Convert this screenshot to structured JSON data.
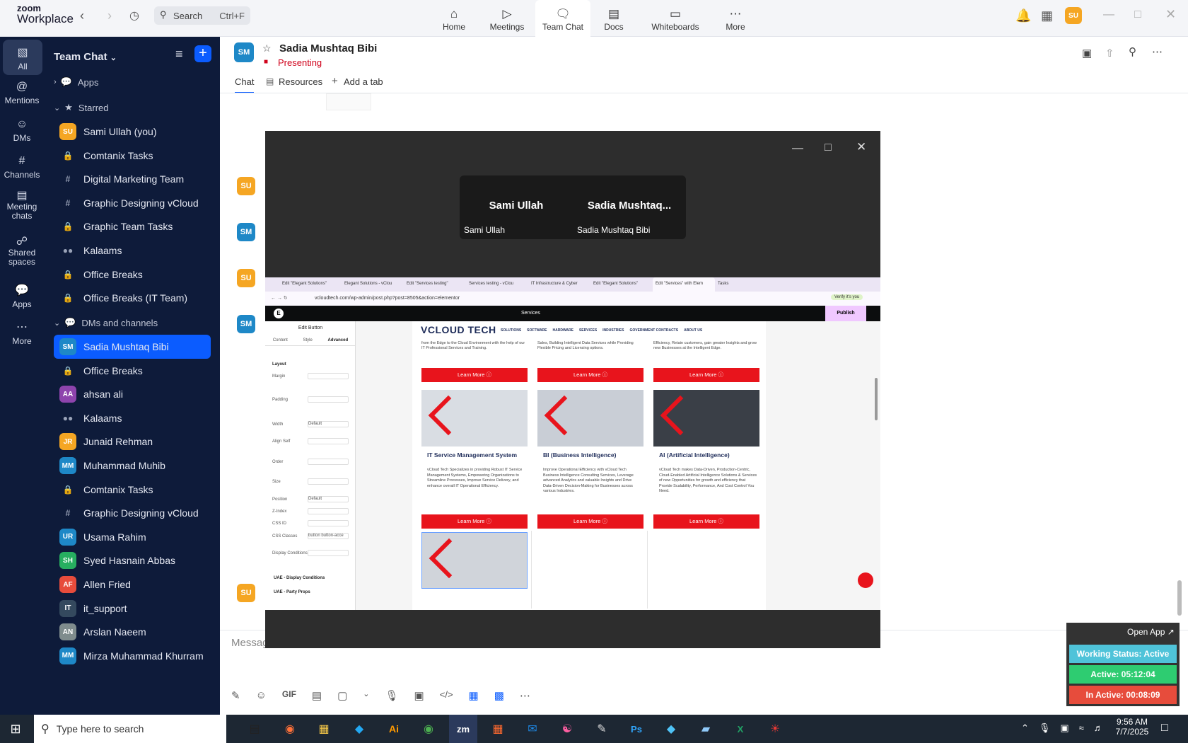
{
  "app": {
    "brand_top": "zoom",
    "brand_bottom": "Workplace"
  },
  "topbar": {
    "search_placeholder": "Search",
    "search_shortcut": "Ctrl+F",
    "nav": [
      {
        "label": "Home",
        "icon": "home-icon"
      },
      {
        "label": "Meetings",
        "icon": "video-icon"
      },
      {
        "label": "Team Chat",
        "icon": "chat-icon"
      },
      {
        "label": "Docs",
        "icon": "doc-icon"
      },
      {
        "label": "Whiteboards",
        "icon": "whiteboard-icon"
      },
      {
        "label": "More",
        "icon": "more-icon"
      }
    ],
    "avatar": "SU"
  },
  "rail": [
    {
      "label": "All",
      "icon": "chat-icon"
    },
    {
      "label": "Mentions",
      "icon": "at-icon"
    },
    {
      "label": "DMs",
      "icon": "people-icon"
    },
    {
      "label": "Channels",
      "icon": "hash-icon"
    },
    {
      "label": "Meeting chats",
      "icon": "calendar-icon"
    },
    {
      "label": "Shared spaces",
      "icon": "shared-icon"
    },
    {
      "label": "Apps",
      "icon": "apps-icon"
    },
    {
      "label": "More",
      "icon": "more-icon"
    }
  ],
  "sidebar": {
    "title": "Team Chat",
    "apps_label": "Apps",
    "starred_label": "Starred",
    "dms_label": "DMs and channels",
    "starred": [
      {
        "label": "Sami Ullah (you)",
        "avatar": "SU",
        "color": "#f5a623",
        "kind": "avatar"
      },
      {
        "label": "Comtanix Tasks",
        "kind": "lock"
      },
      {
        "label": "Digital Marketing Team",
        "kind": "hash"
      },
      {
        "label": "Graphic Designing vCloud",
        "kind": "hash"
      },
      {
        "label": "Graphic Team Tasks",
        "kind": "lock"
      },
      {
        "label": "Kalaams",
        "kind": "group"
      },
      {
        "label": "Office Breaks",
        "kind": "lock"
      },
      {
        "label": "Office Breaks (IT Team)",
        "kind": "lock"
      }
    ],
    "dms": [
      {
        "label": "Sadia Mushtaq Bibi",
        "avatar": "SM",
        "color": "#1e88c7",
        "kind": "avatar",
        "selected": true
      },
      {
        "label": "Office Breaks",
        "kind": "lock"
      },
      {
        "label": "ahsan ali",
        "avatar": "AA",
        "color": "#8e44ad",
        "kind": "avatar"
      },
      {
        "label": "Kalaams",
        "kind": "group"
      },
      {
        "label": "Junaid Rehman",
        "avatar": "JR",
        "color": "#f5a623",
        "kind": "avatar"
      },
      {
        "label": "Muhammad Muhib",
        "avatar": "MM",
        "color": "#1e88c7",
        "kind": "avatar"
      },
      {
        "label": "Comtanix Tasks",
        "kind": "lock"
      },
      {
        "label": "Graphic Designing vCloud",
        "kind": "hash"
      },
      {
        "label": "Usama Rahim",
        "avatar": "UR",
        "color": "#1e88c7",
        "kind": "avatar"
      },
      {
        "label": "Syed Hasnain Abbas",
        "avatar": "SH",
        "color": "#27ae60",
        "kind": "avatar"
      },
      {
        "label": "Allen Fried",
        "avatar": "AF",
        "color": "#e74c3c",
        "kind": "avatar"
      },
      {
        "label": "it_support",
        "avatar": "IT",
        "color": "#34495e",
        "kind": "avatar"
      },
      {
        "label": "Arslan Naeem",
        "avatar": "AN",
        "color": "#7f8c8d",
        "kind": "avatar"
      },
      {
        "label": "Mirza Muhammad Khurram",
        "avatar": "MM",
        "color": "#1e88c7",
        "kind": "avatar"
      }
    ]
  },
  "chat": {
    "avatar": "SM",
    "title": "Sadia Mushtaq Bibi",
    "status": "Presenting",
    "tabs": [
      "Chat",
      "Resources",
      "Add a tab"
    ],
    "composer_placeholder": "Message"
  },
  "share": {
    "tiles": [
      {
        "name": "Sami Ullah",
        "label": "Sami Ullah"
      },
      {
        "name": "Sadia  Mushtaq...",
        "label": "Sadia Mushtaq Bibi"
      }
    ],
    "browser_url": "vcloudtech.com/wp-admin/post.php?post=8505&action=elementor",
    "browser_tabs": [
      "Edit \"Elegant Solutions\"",
      "Elegant Solutions - vClou",
      "Edit \"Services testing\"",
      "Services testing - vClou",
      "IT Infrastructure & Cyber",
      "Edit \"Elegant Solutions\"",
      "Edit \"Services\" with Elem",
      "Tasks"
    ],
    "editor": {
      "toolbar_label": "Services",
      "publish": "Publish",
      "panel_title": "Edit Button",
      "panel_tabs": [
        "Content",
        "Style",
        "Advanced"
      ],
      "section": "Layout",
      "fields": [
        "Margin",
        "Padding",
        "Width",
        "Align Self",
        "Order",
        "Size",
        "Position",
        "Z-Index",
        "CSS ID",
        "CSS Classes",
        "Display Conditions"
      ],
      "width_value": "Default",
      "position_value": "Default",
      "css_classes_value": "button button-acce",
      "footer_sections": [
        "UAE - Display Conditions",
        "UAE - Party Props"
      ]
    },
    "site": {
      "logo": "VCLOUD TECH",
      "menu": [
        "SOLUTIONS",
        "SOFTWARE",
        "HARDWARE",
        "SERVICES",
        "INDUSTRIES",
        "GOVERNMENT CONTRACTS",
        "ABOUT US"
      ],
      "top_texts": [
        "from the Edge to the Cloud Environment with the help of our IT Professional Services and Training.",
        "Sales, Building Intelligent Data Services while Providing Flexible Pricing and Licensing options.",
        "Efficiency, Retain customers, gain greater Insights and grow new Businesses at the Intelligent Edge."
      ],
      "cards": [
        {
          "title": "IT Service Management System",
          "text": "vCloud Tech Specializes in providing Robust IT Service Management Systems, Empowering Organizations to Streamline Processes, Improve Service Delivery, and enhance overall IT Operational Efficiency."
        },
        {
          "title": "BI (Business Intelligence)",
          "text": "Improve Operational Efficiency with vCloud Tech Business Intelligence Consulting Services, Leverage advanced Analytics and valuable Insights and Drive Data-Driven Decision-Making for Businesses across various Industries."
        },
        {
          "title": "AI (Artificial Intelligence)",
          "text": "vCloud Tech makes Data-Driven, Production-Centric, Cloud-Enabled Artificial Intelligence Solutions & Services of new Opportunities for growth and efficiency that Provide Scalability, Performance, And Cost Control You Need."
        }
      ],
      "learn_more": "Learn More"
    }
  },
  "status_widget": {
    "open_app": "Open App ↗",
    "working": "Working Status: Active",
    "active": "Active: 05:12:04",
    "inactive": "In Active: 00:08:09"
  },
  "taskbar": {
    "search_placeholder": "Type here to search",
    "time": "9:56 AM",
    "date": "7/7/2025"
  },
  "colors": {
    "accent": "#0b5cff",
    "sidebar": "#0e1b3a",
    "brand_red": "#e8141c",
    "status_green": "#2ecc71",
    "status_red": "#e74c3c"
  }
}
